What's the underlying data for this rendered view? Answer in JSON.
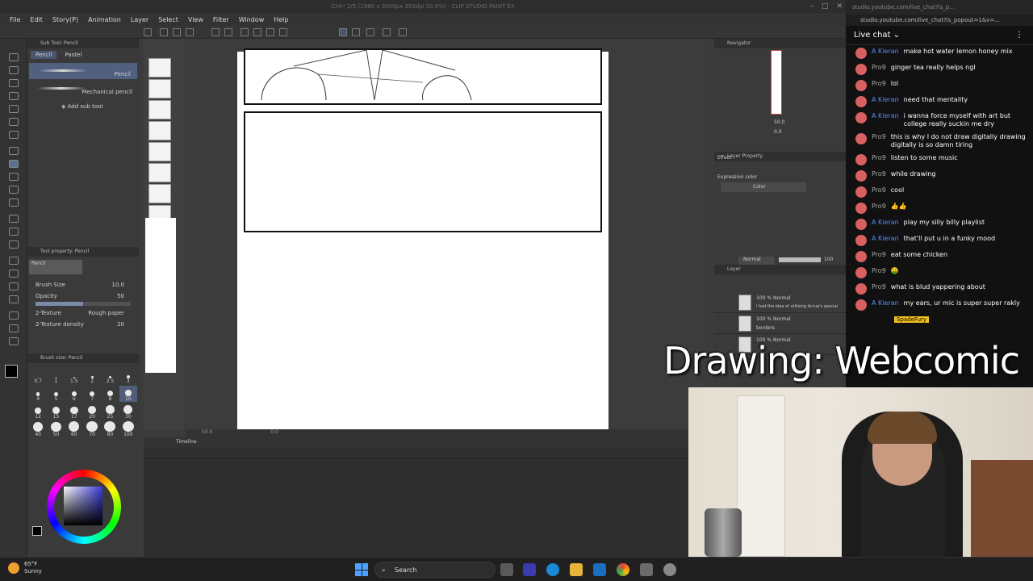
{
  "app": {
    "title": "Chit* 2/5 (1980 x 3000px 350dpi 50.0%) - CLIP STUDIO PAINT EX",
    "menu": [
      "File",
      "Edit",
      "Story(P)",
      "Animation",
      "Layer",
      "Select",
      "View",
      "Filter",
      "Window",
      "Help"
    ]
  },
  "subtool": {
    "header": "Sub Tool: Pencil",
    "tabs": [
      "Pencil",
      "Pastel"
    ],
    "brushes": [
      "Pencil",
      "Mechanical pencil"
    ],
    "add_label": "Add sub tool"
  },
  "tool_property": {
    "header": "Tool property: Pencil",
    "preset": "Pencil",
    "brush_size_label": "Brush Size",
    "brush_size_value": "10.0",
    "opacity_label": "Opacity",
    "opacity_value": "50",
    "opacity_level": 0.5,
    "texture_label": "2-Texture",
    "texture_value": "Rough paper",
    "density_label": "2-Texture density",
    "density_value": "20"
  },
  "brush_size": {
    "header": "Brush size: Pencil",
    "sizes": [
      "0.7",
      "1",
      "1.5",
      "2",
      "2.5",
      "3",
      "4",
      "5",
      "6",
      "7",
      "8",
      "10",
      "12",
      "15",
      "17",
      "20",
      "25",
      "30",
      "40",
      "50",
      "60",
      "70",
      "80",
      "100"
    ]
  },
  "color": {
    "main": "#000000",
    "accent": "#3b3bdc"
  },
  "canvas": {
    "zoom": "50.0",
    "angle": "0.0"
  },
  "timeline": {
    "header": "Timeline"
  },
  "navigator": {
    "header": "Navigator",
    "zoom": "50.0",
    "angle": "0.0"
  },
  "layer_property": {
    "header": "Layer Property",
    "effect": "Effect",
    "expression": "Expression color",
    "color": "Color"
  },
  "layers": {
    "header": "Layer",
    "blend": "Normal",
    "opacity": "100",
    "rows": [
      {
        "mode": "100 % Normal",
        "name": "i had the idea of utilizing Acrua's special"
      },
      {
        "mode": "100 % Normal",
        "name": "borders"
      },
      {
        "mode": "100 % Normal",
        "name": ""
      }
    ]
  },
  "browser": {
    "tab": "studio.youtube.com/live_chat?is_p...",
    "url": "studio.youtube.com/live_chat?is_popout=1&v=..."
  },
  "chat": {
    "title": "Live chat",
    "messages": [
      {
        "author": "A Kieran",
        "mod": true,
        "text": "make hot water lemon honey mix"
      },
      {
        "author": "Pro9",
        "mod": false,
        "text": "ginger tea really helps ngl"
      },
      {
        "author": "Pro9",
        "mod": false,
        "text": "lol"
      },
      {
        "author": "A Kieran",
        "mod": true,
        "text": "need that mentality"
      },
      {
        "author": "A Kieran",
        "mod": true,
        "text": "i wanna force myself with art but college really suckin me dry"
      },
      {
        "author": "Pro9",
        "mod": false,
        "text": "this is why I do not draw digitally drawing digitally is so damn tiring"
      },
      {
        "author": "Pro9",
        "mod": false,
        "text": "listen to some music"
      },
      {
        "author": "Pro9",
        "mod": false,
        "text": "while drawing"
      },
      {
        "author": "Pro9",
        "mod": false,
        "text": "cool"
      },
      {
        "author": "Pro9",
        "mod": false,
        "text": "👍👍"
      },
      {
        "author": "A Kieran",
        "mod": true,
        "text": "play my silly billy playlist"
      },
      {
        "author": "A Kieran",
        "mod": true,
        "text": "that'll put u in a funky mood"
      },
      {
        "author": "Pro9",
        "mod": false,
        "text": "eat some chicken"
      },
      {
        "author": "Pro9",
        "mod": false,
        "text": "🤑"
      },
      {
        "author": "Pro9",
        "mod": false,
        "text": "what is blud yappering about"
      },
      {
        "author": "A Kieran",
        "mod": true,
        "text": "my ears, ur mic is super super rakly"
      }
    ],
    "bottom_user": "SpadeFury"
  },
  "overlay": {
    "title": "Drawing: Webcomic"
  },
  "taskbar": {
    "temp": "65°F",
    "weather": "Sunny",
    "search": "Search"
  }
}
